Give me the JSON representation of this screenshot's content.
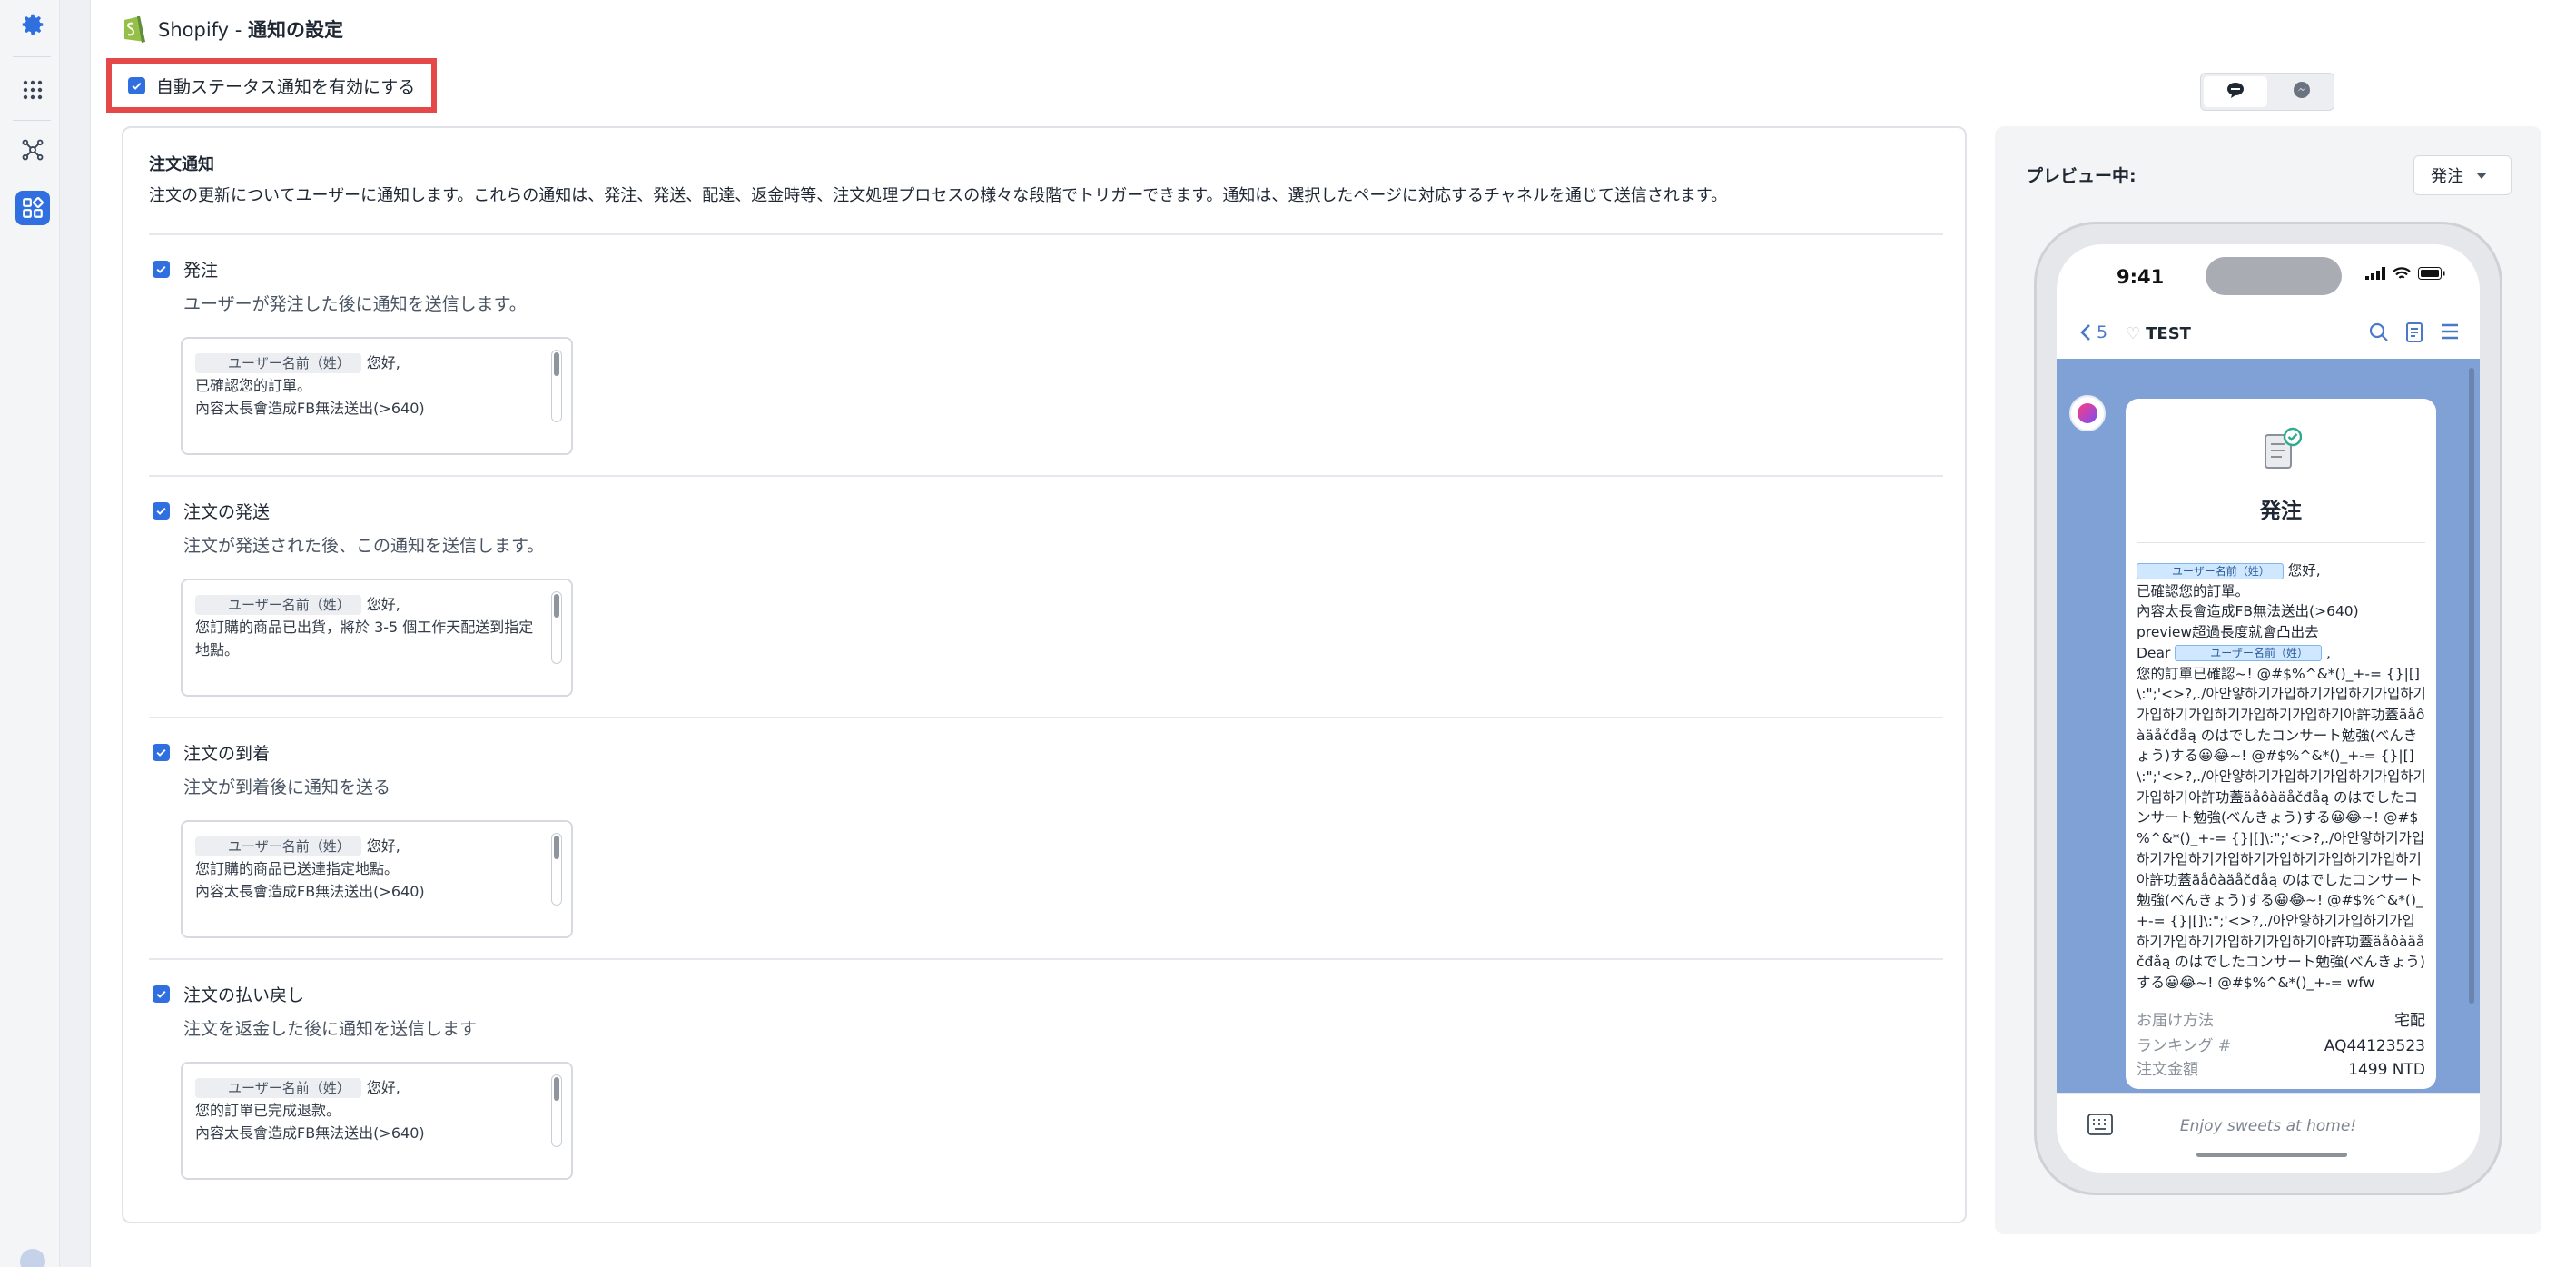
{
  "header": {
    "app": "Shopify",
    "separator": " - ",
    "title": "通知の設定"
  },
  "auto_status": {
    "label": "自動ステータス通知を有効にする",
    "checked": true
  },
  "order_notifications": {
    "title": "注文通知",
    "description": "注文の更新についてユーザーに通知します。これらの通知は、発注、発送、配達、返金時等、注文処理プロセスの様々な段階でトリガーできます。通知は、選択したページに対応するチャネルを通じて送信されます。",
    "sections": [
      {
        "title": "発注",
        "description": "ユーザーが発注した後に通知を送信します。",
        "checked": true,
        "tag": "ユーザー名前（姓）",
        "greeting": "您好,",
        "line2": "已確認您的訂單。",
        "line3": "內容太長會造成FB無法送出(>640)"
      },
      {
        "title": "注文の発送",
        "description": "注文が発送された後、この通知を送信します。",
        "checked": true,
        "tag": "ユーザー名前（姓）",
        "greeting": "您好,",
        "line2": "您訂購的商品已出貨，將於 3-5 個工作天配送到指定",
        "line3": "地點。"
      },
      {
        "title": "注文の到着",
        "description": "注文が到着後に通知を送る",
        "checked": true,
        "tag": "ユーザー名前（姓）",
        "greeting": "您好,",
        "line2": "您訂購的商品已送達指定地點。",
        "line3": "內容太長會造成FB無法送出(>640)"
      },
      {
        "title": "注文の払い戻し",
        "description": "注文を返金した後に通知を送信します",
        "checked": true,
        "tag": "ユーザー名前（姓）",
        "greeting": "您好,",
        "line2": "您的訂單已完成退款。",
        "line3": "內容太長會造成FB無法送出(>640)"
      }
    ]
  },
  "preview": {
    "label": "プレビュー中:",
    "selected": "発注",
    "channels": [
      "line-icon",
      "messenger-icon"
    ],
    "active_channel": "line-icon"
  },
  "phone": {
    "time": "9:41",
    "back_count": "5",
    "chat_name": "TEST",
    "bubble_title": "発注",
    "tag": "ユーザー名前（姓）",
    "greeting": "您好,",
    "line_confirm": "已確認您的訂單。",
    "line_warn": "內容太長會造成FB無法送出(>640)",
    "line_preview": "preview超過長度就會凸出去",
    "dear": "Dear",
    "comma": ",",
    "long_text": "您的訂單已確認~! @#$%^&*()_+-= {}|[]\\:\";'<>?,./아안얗하기가입하기가입하기가입하기가입하기가입하기가입하기가입하기아許功蓋äåôàäåčđåą のはでしたコンサート勉強(べんきょう)する😀😂~! @#$%^&*()_+-= {}|[]\\:\";'<>?,./아안얗하기가입하기가입하기가입하기가입하기아許功蓋äåôàäåčđåą のはでしたコンサート勉強(べんきょう)する😀😂~! @#$%^&*()_+-= {}|[]\\:\";'<>?,./아안얗하기가입하기가입하기가입하기가입하기가입하기가입하기아許功蓋äåôàäåčđåą のはでしたコンサート勉強(べんきょう)する😀😂~! @#$%^&*()_+-= {}|[]\\:\";'<>?,./아안얗하기가입하기가입하기가입하기가입하기가입하기아許功蓋äåôàäåčđåą のはでしたコンサート勉強(べんきょう)する😀😂~! @#$%^&*()_+-= wfw",
    "details": [
      {
        "key": "お届け方法",
        "value": "宅配"
      },
      {
        "key": "ランキング #",
        "value": "AQ44123523"
      },
      {
        "key": "注文金額",
        "value": "1499 NTD"
      }
    ],
    "input_placeholder": "Enjoy sweets at home!"
  },
  "colors": {
    "accent": "#2f6fe0",
    "highlight_border": "#e44848",
    "chat_background": "#7fa1d6"
  }
}
